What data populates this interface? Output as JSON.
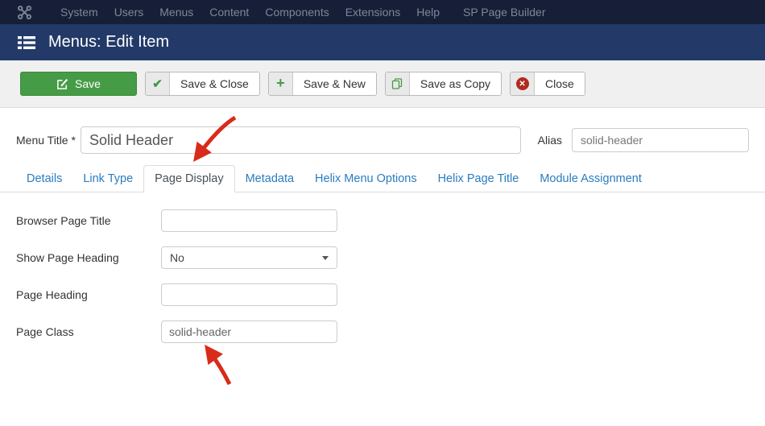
{
  "topbar": {
    "items": [
      {
        "label": "System"
      },
      {
        "label": "Users"
      },
      {
        "label": "Menus"
      },
      {
        "label": "Content"
      },
      {
        "label": "Components"
      },
      {
        "label": "Extensions"
      },
      {
        "label": "Help"
      },
      {
        "label": "SP Page Builder"
      }
    ]
  },
  "header": {
    "title": "Menus: Edit Item"
  },
  "toolbar": {
    "save": "Save",
    "save_close": "Save & Close",
    "save_new": "Save & New",
    "save_copy": "Save as Copy",
    "close": "Close",
    "check_glyph": "✔",
    "plus_glyph": "+",
    "close_glyph": "✕"
  },
  "title_row": {
    "menu_title_label": "Menu Title *",
    "menu_title_value": "Solid Header",
    "alias_label": "Alias",
    "alias_value": "solid-header"
  },
  "tabs": [
    {
      "label": "Details",
      "active": false
    },
    {
      "label": "Link Type",
      "active": false
    },
    {
      "label": "Page Display",
      "active": true
    },
    {
      "label": "Metadata",
      "active": false
    },
    {
      "label": "Helix Menu Options",
      "active": false
    },
    {
      "label": "Helix Page Title",
      "active": false
    },
    {
      "label": "Module Assignment",
      "active": false
    }
  ],
  "fields": [
    {
      "label": "Browser Page Title",
      "value": "",
      "type": "text"
    },
    {
      "label": "Show Page Heading",
      "value": "No",
      "type": "select"
    },
    {
      "label": "Page Heading",
      "value": "",
      "type": "text"
    },
    {
      "label": "Page Class",
      "value": "solid-header",
      "type": "text"
    }
  ],
  "colors": {
    "topbar_bg": "#161f37",
    "header_bg": "#233a68",
    "accent_green": "#469b46",
    "link_blue": "#2a7cc0",
    "arrow_red": "#d92b1b",
    "close_red": "#b12a21"
  }
}
